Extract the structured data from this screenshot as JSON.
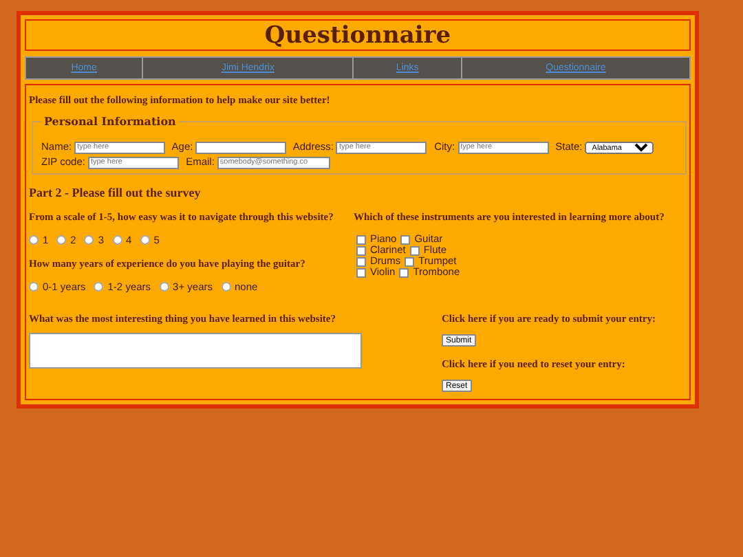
{
  "header": {
    "title": "Questionnaire"
  },
  "nav": [
    {
      "label": "Home"
    },
    {
      "label": "Jimi Hendrix"
    },
    {
      "label": "Links"
    },
    {
      "label": "Questionnaire"
    }
  ],
  "intro": "Please fill out the following information to help make our site better!",
  "personal": {
    "legend": "Personal Information",
    "fields": [
      {
        "label": "Name:",
        "kind": "text",
        "placeholder": "type here"
      },
      {
        "label": "Age:",
        "kind": "text"
      },
      {
        "label": "Address:",
        "kind": "text",
        "placeholder": "type here"
      },
      {
        "label": "City:",
        "kind": "text",
        "placeholder": "type here"
      },
      {
        "label": "State:",
        "kind": "select",
        "value": "Alabama"
      },
      {
        "label": "ZIP code:",
        "kind": "text",
        "placeholder": "type here"
      },
      {
        "label": "Email:",
        "kind": "text",
        "placeholder": "somebody@something.co"
      }
    ]
  },
  "survey": {
    "title": "Part 2 - Please fill out the survey",
    "q1": {
      "question": "From a scale of 1-5, how easy was it to navigate through this website?",
      "options": [
        {
          "label": "1",
          "selected": false
        },
        {
          "label": "2",
          "selected": false
        },
        {
          "label": "3",
          "selected": false
        },
        {
          "label": "4",
          "selected": false
        },
        {
          "label": "5",
          "selected": false
        }
      ]
    },
    "q2": {
      "question": "How many years of experience do you have playing the guitar?",
      "options": [
        {
          "label": "0-1 years",
          "selected": false
        },
        {
          "label": "1-2 years",
          "selected": false
        },
        {
          "label": "3+ years",
          "selected": false
        },
        {
          "label": "none",
          "selected": false
        }
      ]
    },
    "q3": {
      "question": "Which of these instruments are you interested in learning more about?",
      "rows": [
        [
          {
            "label": "Piano",
            "checked": false
          },
          {
            "label": "Guitar",
            "checked": false
          }
        ],
        [
          {
            "label": "Clarinet",
            "checked": false
          },
          {
            "label": "Flute",
            "checked": false
          }
        ],
        [
          {
            "label": "Drums",
            "checked": false
          },
          {
            "label": "Trumpet",
            "checked": false
          }
        ],
        [
          {
            "label": "Violin",
            "checked": false
          },
          {
            "label": "Trombone",
            "checked": false
          }
        ]
      ]
    },
    "q4": {
      "question": "What was the most interesting thing you have learned in this website?"
    },
    "submit": {
      "prompt": "Click here if you are ready to submit your entry:",
      "button": "Submit"
    },
    "reset": {
      "prompt": "Click here if you need to reset your entry:",
      "button": "Reset"
    }
  }
}
